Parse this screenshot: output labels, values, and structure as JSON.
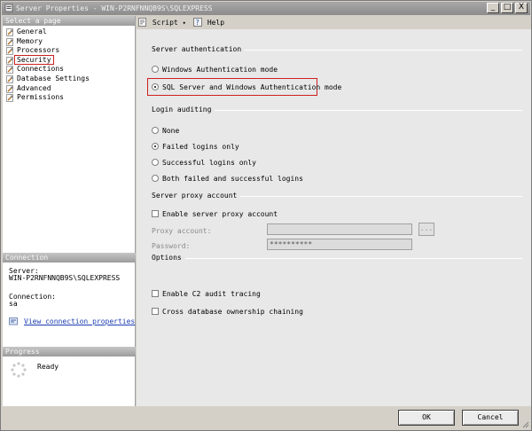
{
  "window": {
    "title": "Server Properties - WIN-P2RNFNNQB9S\\SQLEXPRESS",
    "controls": {
      "minimize": "_",
      "maximize": "□",
      "close": "X"
    }
  },
  "left_panel": {
    "select_page_header": "Select a page",
    "pages": [
      {
        "label": "General",
        "icon": "wrench-page-icon"
      },
      {
        "label": "Memory",
        "icon": "wrench-page-icon"
      },
      {
        "label": "Processors",
        "icon": "wrench-page-icon"
      },
      {
        "label": "Security",
        "icon": "wrench-page-icon",
        "selected": true
      },
      {
        "label": "Connections",
        "icon": "wrench-page-icon"
      },
      {
        "label": "Database Settings",
        "icon": "wrench-page-icon"
      },
      {
        "label": "Advanced",
        "icon": "wrench-page-icon"
      },
      {
        "label": "Permissions",
        "icon": "wrench-page-icon"
      }
    ],
    "connection_header": "Connection",
    "server_label": "Server:",
    "server_value": "WIN-P2RNFNNQB9S\\SQLEXPRESS",
    "connection_label": "Connection:",
    "connection_value": "sa",
    "view_connection_link": "View connection properties",
    "progress_header": "Progress",
    "progress_status": "Ready"
  },
  "toolbar": {
    "script_label": "Script",
    "help_label": "Help"
  },
  "security": {
    "server_auth_title": "Server authentication",
    "windows_auth": "Windows Authentication mode",
    "mixed_auth": "SQL Server and Windows Authentication mode",
    "login_auditing_title": "Login auditing",
    "audit_none": "None",
    "audit_failed": "Failed logins only",
    "audit_success": "Successful logins only",
    "audit_both": "Both failed and successful logins",
    "proxy_title": "Server proxy account",
    "enable_proxy": "Enable server proxy account",
    "proxy_account_label": "Proxy account:",
    "proxy_account_value": "",
    "password_label": "Password:",
    "password_value": "**********",
    "browse_label": "...",
    "options_title": "Options",
    "c2_audit": "Enable C2 audit tracing",
    "cross_db": "Cross database ownership chaining"
  },
  "dialog_buttons": {
    "ok": "OK",
    "cancel": "Cancel"
  },
  "colors": {
    "highlight": "#cc2020",
    "link": "#1a3cb0"
  }
}
